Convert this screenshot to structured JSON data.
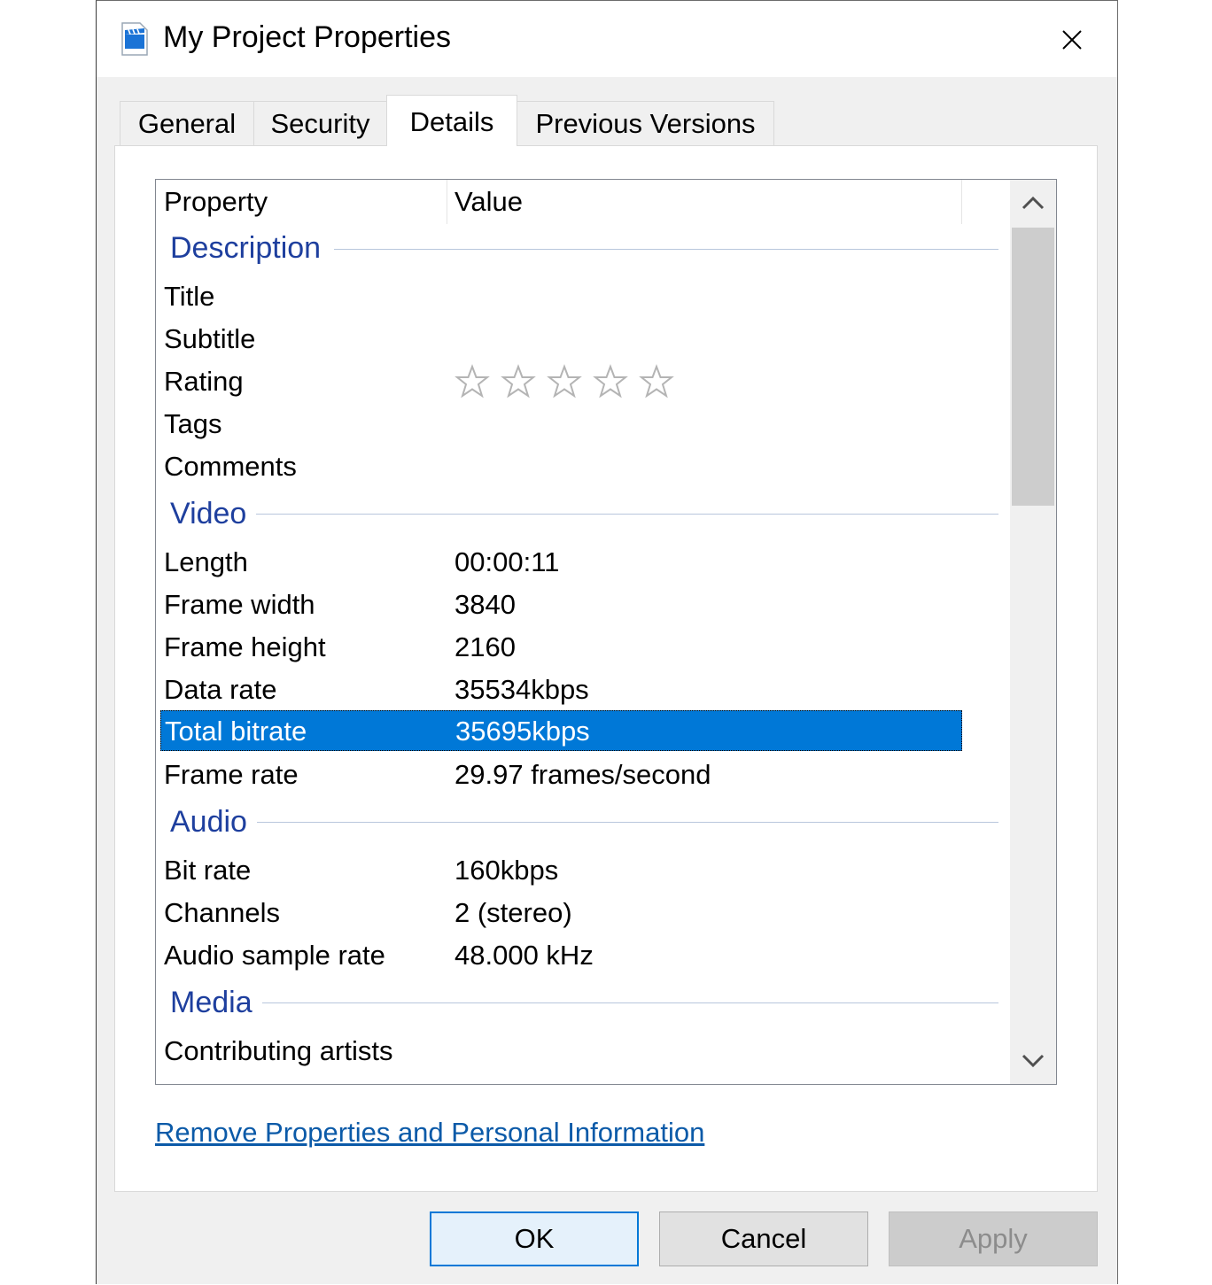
{
  "window": {
    "title": "My Project Properties"
  },
  "icons": {
    "app": "video-file-icon",
    "close": "close-icon",
    "scroll_up": "chevron-up-icon",
    "scroll_down": "chevron-down-icon",
    "star": "star-outline-icon"
  },
  "tabs": [
    {
      "label": "General"
    },
    {
      "label": "Security"
    },
    {
      "label": "Details",
      "active": true
    },
    {
      "label": "Previous Versions"
    }
  ],
  "columns": {
    "property": "Property",
    "value": "Value"
  },
  "groups": {
    "description": "Description",
    "video": "Video",
    "audio": "Audio",
    "media": "Media"
  },
  "description_rows": [
    {
      "key": "Title",
      "value": ""
    },
    {
      "key": "Subtitle",
      "value": ""
    },
    {
      "key": "Rating",
      "rating": 0,
      "max": 5
    },
    {
      "key": "Tags",
      "value": ""
    },
    {
      "key": "Comments",
      "value": ""
    }
  ],
  "video_rows": [
    {
      "key": "Length",
      "value": "00:00:11"
    },
    {
      "key": "Frame width",
      "value": "3840"
    },
    {
      "key": "Frame height",
      "value": "2160"
    },
    {
      "key": "Data rate",
      "value": "35534kbps"
    },
    {
      "key": "Total bitrate",
      "value": "35695kbps",
      "selected": true
    },
    {
      "key": "Frame rate",
      "value": "29.97 frames/second"
    }
  ],
  "audio_rows": [
    {
      "key": "Bit rate",
      "value": "160kbps"
    },
    {
      "key": "Channels",
      "value": "2 (stereo)"
    },
    {
      "key": "Audio sample rate",
      "value": "48.000 kHz"
    }
  ],
  "media_rows": [
    {
      "key": "Contributing artists",
      "value": ""
    }
  ],
  "link": "Remove Properties and Personal Information",
  "buttons": {
    "ok": "OK",
    "cancel": "Cancel",
    "apply": "Apply"
  },
  "colors": {
    "selection": "#0078d7",
    "group_header": "#1e3f9e",
    "link": "#0b5aa8"
  }
}
